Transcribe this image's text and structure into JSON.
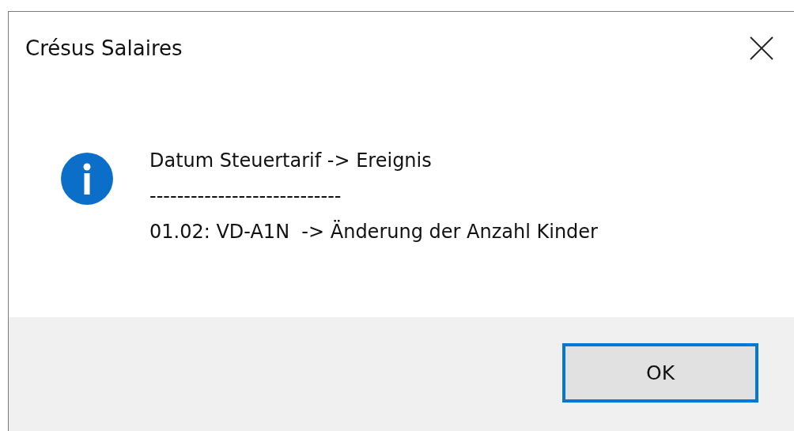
{
  "window": {
    "title": "Crésus Salaires"
  },
  "message": {
    "lines": [
      "Datum Steuertarif -> Ereignis",
      "----------------------------",
      "01.02: VD-A1N  -> Änderung der Anzahl Kinder"
    ]
  },
  "buttons": [
    {
      "label": "OK",
      "selected": true
    }
  ]
}
